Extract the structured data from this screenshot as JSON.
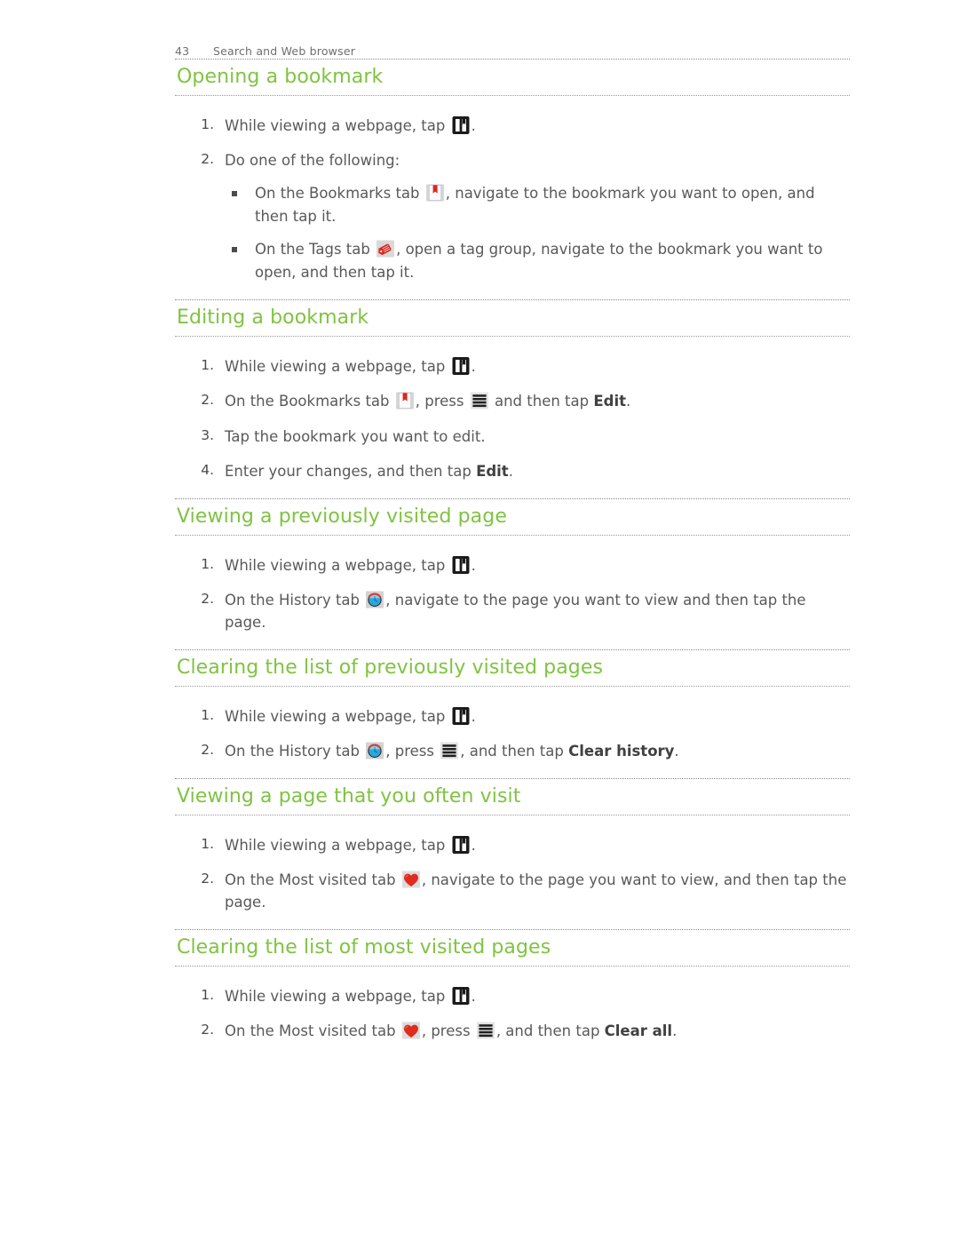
{
  "header": {
    "folio": "43",
    "chapter": "Search and Web browser"
  },
  "icons": {
    "bookmark_button": "bookmark-button-icon",
    "bookmarks_tab": "bookmarks-tab-icon",
    "tags_tab": "tags-tab-icon",
    "history_tab": "history-tab-icon",
    "most_visited_tab": "most-visited-heart-icon",
    "menu": "menu-icon"
  },
  "colors": {
    "heading_green": "#80c342",
    "body_text": "#58595b",
    "rule": "#8a8a8a",
    "bookmark_red": "#d9281f",
    "history_blue": "#29a8e0",
    "heart_red": "#e02b1d"
  },
  "sections": [
    {
      "title": "Opening a bookmark",
      "steps": [
        {
          "num": "1.",
          "before": "While viewing a webpage, tap ",
          "icon": "bookmark_button",
          "after": "."
        },
        {
          "num": "2.",
          "before": "Do one of the following:",
          "bullets": [
            {
              "before": "On the Bookmarks tab ",
              "icon": "bookmarks_tab",
              "after": ", navigate to the bookmark you want to open, and then tap it."
            },
            {
              "before": "On the Tags tab ",
              "icon": "tags_tab",
              "after": ", open a tag group, navigate to the bookmark you want to open, and then tap it."
            }
          ]
        }
      ]
    },
    {
      "title": "Editing a bookmark",
      "steps": [
        {
          "num": "1.",
          "before": "While viewing a webpage, tap ",
          "icon": "bookmark_button",
          "after": "."
        },
        {
          "num": "2.",
          "before": "On the Bookmarks tab ",
          "icon": "bookmarks_tab",
          "mid": ", press ",
          "icon2": "menu",
          "after": " and then tap ",
          "bold": "Edit",
          "tail": "."
        },
        {
          "num": "3.",
          "before": "Tap the bookmark you want to edit."
        },
        {
          "num": "4.",
          "before": "Enter your changes, and then tap ",
          "bold": "Edit",
          "tail": "."
        }
      ]
    },
    {
      "title": "Viewing a previously visited page",
      "steps": [
        {
          "num": "1.",
          "before": "While viewing a webpage, tap ",
          "icon": "bookmark_button",
          "after": "."
        },
        {
          "num": "2.",
          "before": "On the History tab ",
          "icon": "history_tab",
          "after": ", navigate to the page you want to view and then tap the page."
        }
      ]
    },
    {
      "title": "Clearing the list of previously visited pages",
      "steps": [
        {
          "num": "1.",
          "before": "While viewing a webpage, tap ",
          "icon": "bookmark_button",
          "after": "."
        },
        {
          "num": "2.",
          "before": "On the History tab ",
          "icon": "history_tab",
          "mid": ", press ",
          "icon2": "menu",
          "after": ", and then tap ",
          "bold": "Clear history",
          "tail": "."
        }
      ]
    },
    {
      "title": "Viewing a page that you often visit",
      "steps": [
        {
          "num": "1.",
          "before": "While viewing a webpage, tap ",
          "icon": "bookmark_button",
          "after": "."
        },
        {
          "num": "2.",
          "before": "On the Most visited tab ",
          "icon": "most_visited_tab",
          "after": ", navigate to the page you want to view, and then tap the page."
        }
      ]
    },
    {
      "title": "Clearing the list of most visited pages",
      "steps": [
        {
          "num": "1.",
          "before": "While viewing a webpage, tap ",
          "icon": "bookmark_button",
          "after": "."
        },
        {
          "num": "2.",
          "before": "On the Most visited tab ",
          "icon": "most_visited_tab",
          "mid": ", press ",
          "icon2": "menu",
          "after": ", and then tap ",
          "bold": "Clear all",
          "tail": "."
        }
      ]
    }
  ]
}
